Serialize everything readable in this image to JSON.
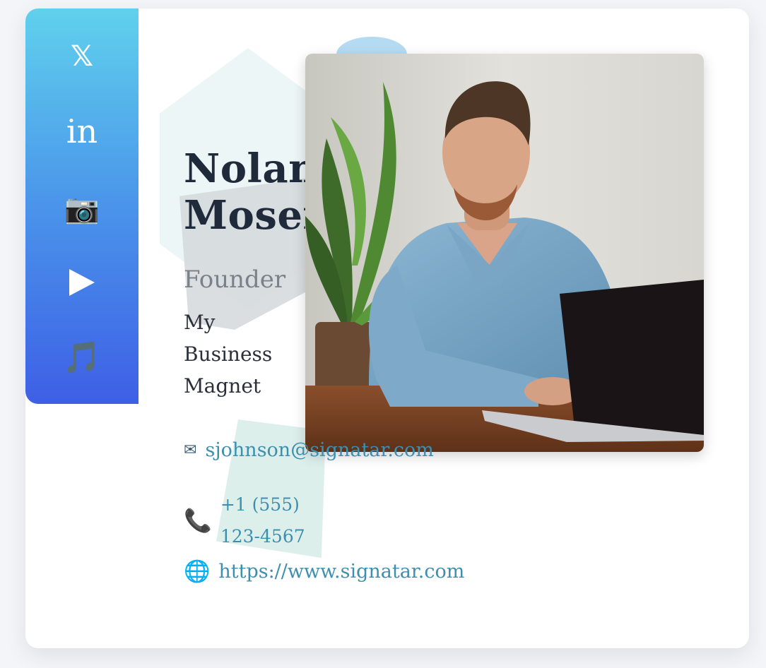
{
  "social": [
    {
      "network": "x",
      "icon": "x-logo-icon",
      "glyph": "𝕏"
    },
    {
      "network": "linkedin",
      "icon": "linkedin-icon",
      "glyph": "in"
    },
    {
      "network": "instagram",
      "icon": "camera-icon",
      "glyph": "📷"
    },
    {
      "network": "youtube",
      "icon": "play-icon",
      "glyph": "▶"
    },
    {
      "network": "tiktok",
      "icon": "music-note-icon",
      "glyph": "🎵"
    }
  ],
  "profile": {
    "first_name": "Nolan",
    "last_name": "Moser",
    "title": "Founder",
    "company": "My Business Magnet",
    "photo_alt": "Portrait photo"
  },
  "contact": {
    "email": "sjohnson@signatar.com",
    "email_icon": "envelope-icon",
    "email_glyph": "✉",
    "phone": "+1 (555) 123-4567",
    "phone_icon": "phone-icon",
    "phone_glyph": "📞",
    "website": "https://www.signatar.com",
    "website_icon": "globe-icon",
    "website_glyph": "🌐"
  },
  "colors": {
    "sidebar_top": "#60d1ec",
    "sidebar_bottom": "#3e5fe6",
    "name": "#1f2a3b",
    "title": "#7b818a",
    "link": "#3d8fb0"
  }
}
